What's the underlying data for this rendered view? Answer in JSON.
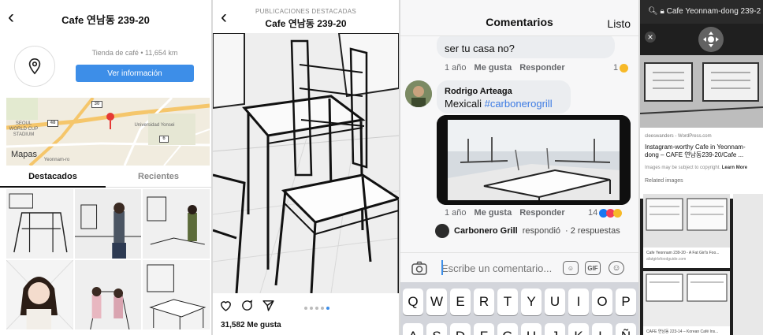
{
  "panel1": {
    "title": "Cafe 연남동 239-20",
    "category_distance": "Tienda de café • 11,654 km",
    "button": "Ver información",
    "map": {
      "brand": "Mapas",
      "labels": [
        "SEOUL WORLD CUP STADIUM",
        "Universidad Yonsei",
        "Yeonnam-ro"
      ],
      "route_numbers": [
        "30",
        "48",
        "6"
      ]
    },
    "tabs": [
      "Destacados",
      "Recientes"
    ]
  },
  "panel2": {
    "supertitle": "PUBLICACIONES DESTACADAS",
    "title": "Cafe 연남동 239-20",
    "likes": "31,582 Me gusta",
    "carousel_active_index": 4,
    "carousel_count": 5
  },
  "panel3": {
    "title": "Comentarios",
    "done": "Listo",
    "comment1": {
      "text": "ser tu casa no?",
      "time": "1 año",
      "like": "Me gusta",
      "reply": "Responder",
      "reactions": "1"
    },
    "comment2": {
      "author": "Rodrigo Arteaga",
      "text": "Mexicali",
      "hashtag": "#carbonerogrill",
      "time": "1 año",
      "like": "Me gusta",
      "reply": "Responder",
      "reactions": "14"
    },
    "reply_summary": {
      "author": "Carbonero Grill",
      "action": "respondió",
      "count": "· 2 respuestas"
    },
    "input_placeholder": "Escribe un comentario...",
    "gif_label": "GIF",
    "keyboard_row1": [
      "Q",
      "W",
      "E",
      "R",
      "T",
      "Y",
      "U",
      "I",
      "O",
      "P"
    ],
    "keyboard_row2": [
      "A",
      "S",
      "D",
      "F",
      "G",
      "H",
      "J",
      "K",
      "L",
      "Ñ"
    ]
  },
  "panel4": {
    "url": "Cafe Yeonnam-dong 239-2",
    "source": "cleeswanders - WordPress.com",
    "title": "Instagram-worthy Cafe in Yeonnam-dong – CAFE 연남동239-20/Cafe ...",
    "copyright": "Images may be subject to copyright.",
    "learn_more": "Learn More",
    "related": "Related images",
    "rel1_caption": "Cafe Yeonnam 239-20 - A Fat Girl's Foo...",
    "rel1_source": "afatgirlsfoodguide.com",
    "rel2_caption": "CAFE 연남동 223-14 – Korean Café Ins..."
  },
  "colors": {
    "accent_blue": "#3d8ee8",
    "hashtag_blue": "#3d7be3",
    "map_pin": "#e53935"
  }
}
